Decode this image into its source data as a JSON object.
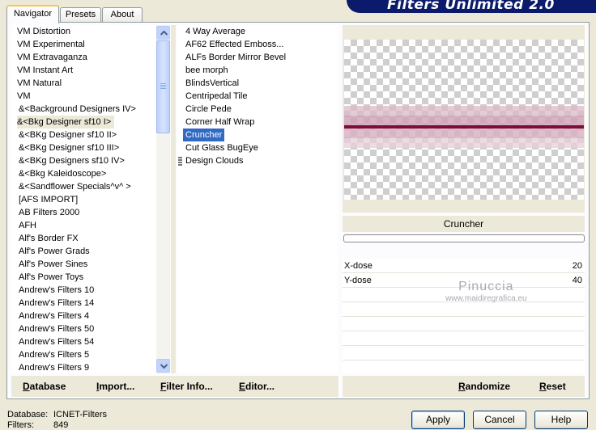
{
  "banner": {
    "title": "Filters Unlimited 2.0"
  },
  "tabs": [
    {
      "label": "Navigator"
    },
    {
      "label": "Presets"
    },
    {
      "label": "About"
    }
  ],
  "categories": {
    "items": [
      "VM Distortion",
      "VM Experimental",
      "VM Extravaganza",
      "VM Instant Art",
      "VM Natural",
      "VM",
      "&<Background Designers IV>",
      "&<Bkg Designer sf10 I>",
      "&<BKg Designer sf10 II>",
      "&<BKg Designer sf10 III>",
      "&<BKg Designers sf10 IV>",
      "&<Bkg Kaleidoscope>",
      "&<Sandflower Specials^v^ >",
      "[AFS IMPORT]",
      "AB Filters 2000",
      "AFH",
      "Alf's Border FX",
      "Alf's Power Grads",
      "Alf's Power Sines",
      "Alf's Power Toys",
      "Andrew's Filters 10",
      "Andrew's Filters 14",
      "Andrew's Filters 4",
      "Andrew's Filters 50",
      "Andrew's Filters 54",
      "Andrew's Filters 5",
      "Andrew's Filters 9"
    ],
    "selected": "&<Bkg Designer sf10 I>"
  },
  "filters": {
    "items": [
      "4 Way Average",
      "AF62 Effected Emboss...",
      "ALFs Border Mirror Bevel",
      "bee morph",
      "BlindsVertical",
      "Centripedal Tile",
      "Circle Pede",
      "Corner Half Wrap",
      "Cruncher",
      "Cut Glass  BugEye",
      "Design Clouds"
    ],
    "selected": "Cruncher"
  },
  "preview": {
    "filter_name": "Cruncher"
  },
  "params": [
    {
      "name": "X-dose",
      "value": "20"
    },
    {
      "name": "Y-dose",
      "value": "40"
    }
  ],
  "watermark": {
    "line1": "Pinuccia",
    "line2": "www.maidiregrafica.eu"
  },
  "left_buttons": {
    "database": "Database",
    "import": "Import...",
    "filter_info": "Filter Info...",
    "editor": "Editor..."
  },
  "right_buttons": {
    "randomize": "Randomize",
    "reset": "Reset"
  },
  "status": {
    "database_label": "Database:",
    "database_value": "ICNET-Filters",
    "filters_label": "Filters:",
    "filters_value": "849"
  },
  "dialog_buttons": {
    "apply": "Apply",
    "cancel": "Cancel",
    "help": "Help"
  },
  "colors": {
    "selection": "#316ac5",
    "banner": "#0b1a6b",
    "stripe": "#7d0c3a",
    "face": "#ece9d8"
  }
}
